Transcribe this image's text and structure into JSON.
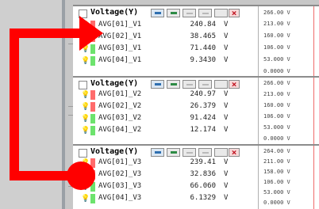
{
  "panels": [
    {
      "title": "Voltage(Y)",
      "rows": [
        {
          "label": "AVG[01]_V1",
          "value": "240.84",
          "unit": "V",
          "color": "#ff6b6b"
        },
        {
          "label": "AVG[02]_V1",
          "value": "38.465",
          "unit": "V",
          "color": "#ff6b6b"
        },
        {
          "label": "AVG[03]_V1",
          "value": "71.440",
          "unit": "V",
          "color": "#6de36d"
        },
        {
          "label": "AVG[04]_V1",
          "value": "9.3430",
          "unit": "V",
          "color": "#6de36d"
        }
      ],
      "ticks": [
        "266.00 V",
        "213.00 V",
        "160.00 V",
        "106.00 V",
        "53.000 V",
        "0.0000 V"
      ]
    },
    {
      "title": "Voltage(Y)",
      "rows": [
        {
          "label": "AVG[01]_V2",
          "value": "240.97",
          "unit": "V",
          "color": "#ff6b6b"
        },
        {
          "label": "AVG[02]_V2",
          "value": "26.379",
          "unit": "V",
          "color": "#ff6b6b"
        },
        {
          "label": "AVG[03]_V2",
          "value": "91.424",
          "unit": "V",
          "color": "#6de36d"
        },
        {
          "label": "AVG[04]_V2",
          "value": "12.174",
          "unit": "V",
          "color": "#6de36d"
        }
      ],
      "ticks": [
        "266.00 V",
        "213.00 V",
        "160.00 V",
        "106.00 V",
        "53.000 V",
        "0.0000 V"
      ]
    },
    {
      "title": "Voltage(Y)",
      "rows": [
        {
          "label": "AVG[01]_V3",
          "value": "239.41",
          "unit": "V",
          "color": "#ff6b6b"
        },
        {
          "label": "AVG[02]_V3",
          "value": "32.836",
          "unit": "V",
          "color": "#ff6b6b"
        },
        {
          "label": "AVG[03]_V3",
          "value": "66.060",
          "unit": "V",
          "color": "#6de36d"
        },
        {
          "label": "AVG[04]_V3",
          "value": "6.1329",
          "unit": "V",
          "color": "#6de36d"
        }
      ],
      "ticks": [
        "264.00 V",
        "211.00 V",
        "158.00 V",
        "106.00 V",
        "53.000 V",
        "0.0000 V"
      ]
    }
  ]
}
